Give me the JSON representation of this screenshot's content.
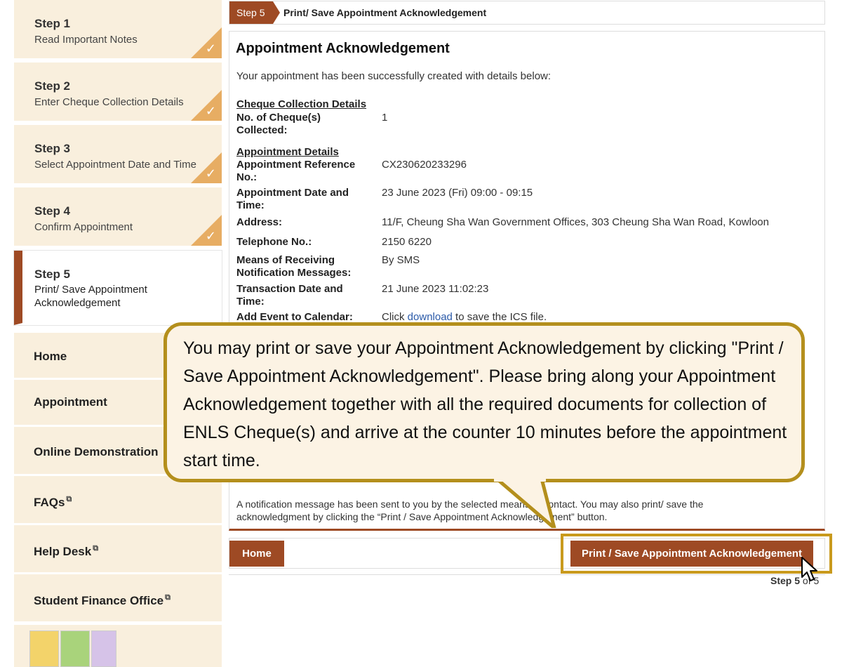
{
  "steps": [
    {
      "num": "Step 1",
      "desc": "Read Important Notes",
      "done": true
    },
    {
      "num": "Step 2",
      "desc": "Enter Cheque Collection Details",
      "done": true
    },
    {
      "num": "Step 3",
      "desc": "Select Appointment Date and Time",
      "done": true
    },
    {
      "num": "Step 4",
      "desc": "Confirm Appointment",
      "done": true
    },
    {
      "num": "Step 5",
      "desc_line1": "Print/ Save Appointment",
      "desc_line2": "Acknowledgement",
      "active": true
    }
  ],
  "tick": "✓",
  "menu": {
    "home": "Home",
    "appointment": "Appointment",
    "demo": "Online Demonstration",
    "faqs": "FAQs",
    "helpdesk": "Help Desk",
    "sfo": "Student Finance Office",
    "ext_icon": "⧉"
  },
  "header": {
    "badge": "Step 5",
    "title": "Print/ Save Appointment Acknowledgement"
  },
  "main": {
    "title": "Appointment Acknowledgement",
    "intro": "Your appointment has been successfully created with details below:",
    "sec_cheque": "Cheque Collection Details",
    "sec_appt": "Appointment Details",
    "rows": {
      "cheques": {
        "k": "No. of Cheque(s) Collected:",
        "v": "1"
      },
      "ref": {
        "k": "Appointment Reference No.:",
        "v": "CX230620233296"
      },
      "datetime": {
        "k": "Appointment Date and Time:",
        "v": "23 June 2023 (Fri) 09:00 - 09:15"
      },
      "address": {
        "k": "Address:",
        "v": "11/F, Cheung Sha Wan Government Offices, 303 Cheung Sha Wan Road, Kowloon"
      },
      "tel": {
        "k": "Telephone No.:",
        "v": "2150 6220"
      },
      "means": {
        "k": "Means of Receiving Notification Messages:",
        "v": "By SMS"
      },
      "txn": {
        "k": "Transaction Date and Time:",
        "v": "21 June 2023 11:02:23"
      },
      "calendar": {
        "k": "Add Event to Calendar:",
        "v_pre": "Click ",
        "v_link": "download",
        "v_post": " to save the ICS file."
      }
    },
    "note_line1": "A notification message has been sent to you by the selected means of contact. You may also print/ save the",
    "note_line2": "acknowledgment by clicking the “Print / Save Appointment Acknowledgement” button."
  },
  "footer": {
    "home_btn": "Home",
    "print_btn": "Print / Save Appointment Acknowledgement",
    "step_of": "Step 5",
    "step_of_rest": " of 5"
  },
  "callout": {
    "text": "You may print or save your Appointment Acknowledgement by clicking \"Print / Save Appointment Acknowledgement\". Please bring along your Appointment Acknowledgement together with all the required documents for collection of ENLS Cheque(s) and arrive at the counter 10 minutes before the appointment start time."
  },
  "colors": {
    "brand": "#9e4a24",
    "step_bg": "#f9efdd",
    "tick_bg": "#e7ad63",
    "callout_border": "#b48f1c",
    "callout_bg": "#fcf3e4"
  }
}
